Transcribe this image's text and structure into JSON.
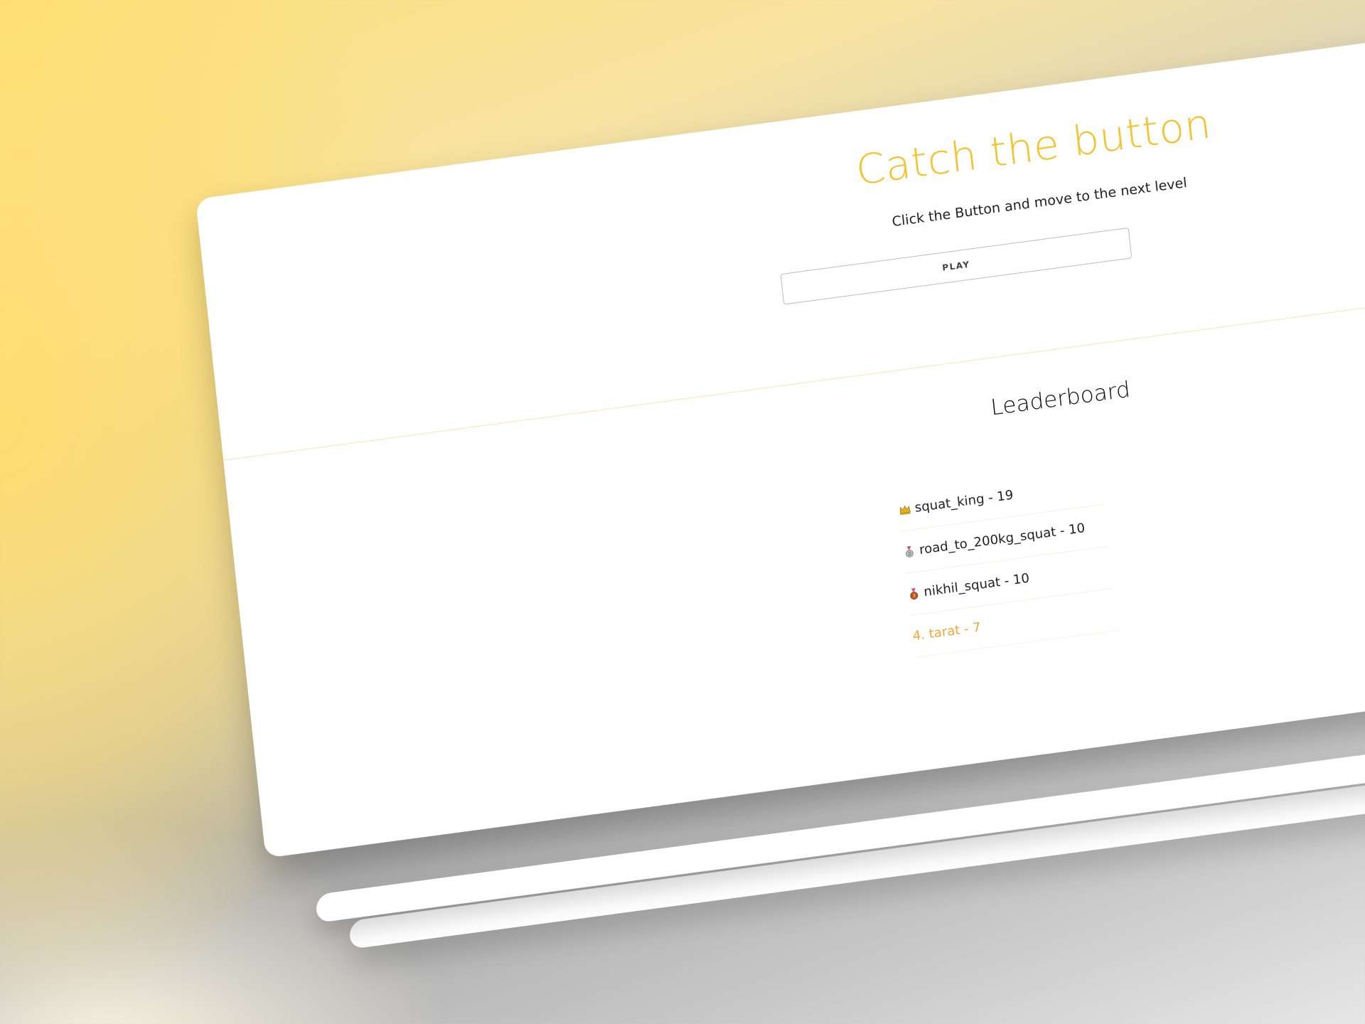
{
  "page": {
    "title": "Catch the button",
    "subtitle": "Click the Button and move to the next level",
    "play_label": "PLAY"
  },
  "leaderboard": {
    "title": "Leaderboard",
    "entries": [
      {
        "icon": "crown-icon",
        "name": "squat_king",
        "score": "19",
        "text": "squat_king - 19"
      },
      {
        "icon": "silver-medal-icon",
        "name": "road_to_200kg_squat",
        "score": "10",
        "text": "road_to_200kg_squat - 10"
      },
      {
        "icon": "bronze-medal-icon",
        "name": "nikhil_squat",
        "score": "10",
        "text": "nikhil_squat - 10"
      },
      {
        "icon": "",
        "name": "tarat",
        "score": "7",
        "text": "4. tarat - 7"
      }
    ]
  },
  "colors": {
    "accent": "#f6c22a",
    "current_player": "#f7a538",
    "divider": "#fbe3ae"
  }
}
